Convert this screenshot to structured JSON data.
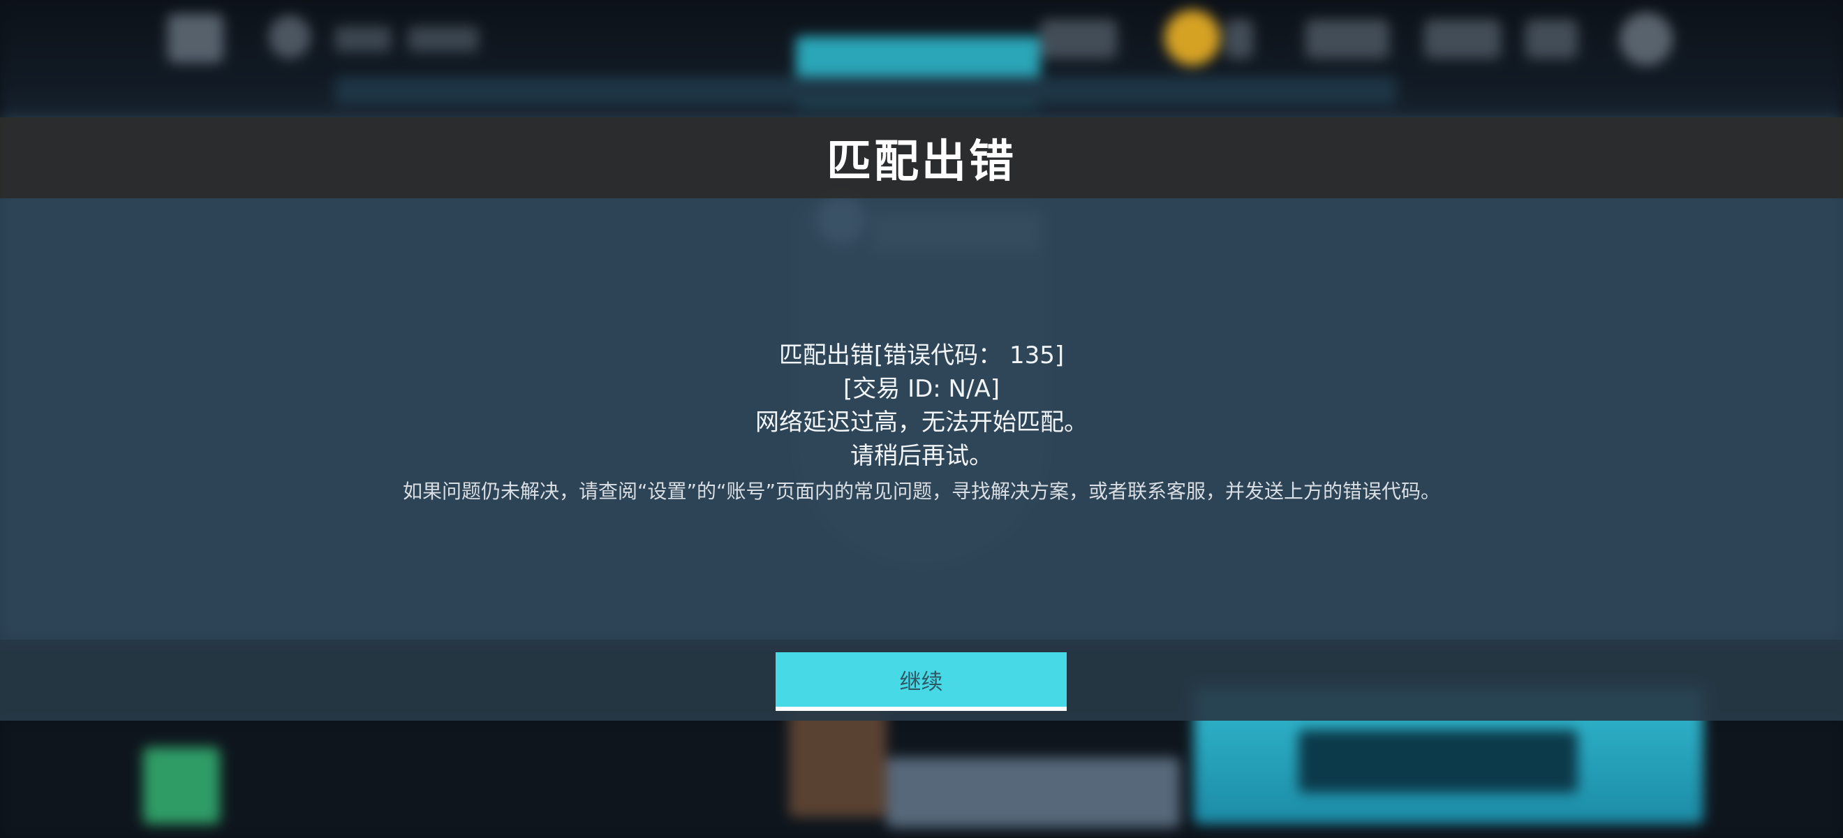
{
  "dialog": {
    "title": "匹配出错",
    "message_lines": [
      "匹配出错[错误代码： 135]",
      "[交易 ID: N/A]",
      "网络延迟过高，无法开始匹配。",
      "请稍后再试。"
    ],
    "help_text": "如果问题仍未解决，请查阅“设置”的“账号”页面内的常见问题，寻找解决方案，或者联系客服，并发送上方的错误代码。",
    "continue_label": "继续"
  },
  "colors": {
    "button": "#47d9e6",
    "title_bar": "#2c2c2c",
    "dialog_body": "#2e4658"
  }
}
